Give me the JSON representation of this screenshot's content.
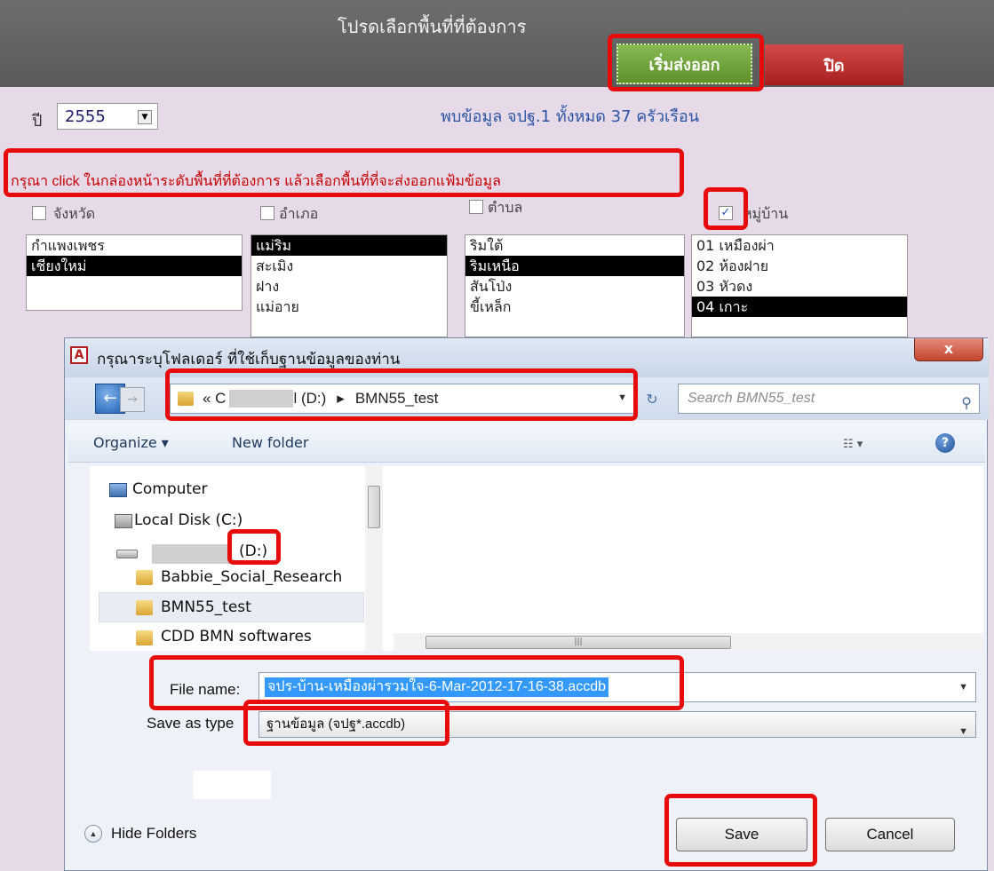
{
  "form": {
    "title": "โปรดเลือกพื้นที่ที่ต้องการ",
    "start_export_label": "เริ่มส่งออก",
    "close_label": "ปิด",
    "year_label": "ปี",
    "year_value": "2555",
    "found_text": "พบข้อมูล จปฐ.1 ทั้งหมด  37  ครัวเรือน",
    "instruction": "กรุณา click ในกล่องหน้าระดับพื้นที่ที่ต้องการ แล้วเลือกพื้นที่ที่จะส่งออกแฟ้มข้อมูล",
    "levels": [
      {
        "label": "จังหวัด",
        "checked": false,
        "items": [
          "กำแพงเพชร",
          "เชียงใหม่"
        ],
        "selected": 1
      },
      {
        "label": "อำเภอ",
        "checked": false,
        "items": [
          "แม่ริม",
          "สะเมิง",
          "ฝาง",
          "แม่อาย"
        ],
        "selected": 0
      },
      {
        "label": "ตำบล",
        "checked": false,
        "items": [
          "ริมใต้",
          "ริมเหนือ",
          "สันโป่ง",
          "ขี้เหล็ก"
        ],
        "selected": 1
      },
      {
        "label": "หมู่บ้าน",
        "checked": true,
        "items": [
          "01 เหมืองผ่า",
          "02 ห้องฝาย",
          "03 หัวดง",
          "04 เกาะ"
        ],
        "selected": 3
      }
    ]
  },
  "dialog": {
    "title": "กรุณาระบุโฟลเดอร์ ที่ใช้เก็บฐานข้อมูลของท่าน",
    "close_glyph": "x",
    "address": {
      "prefix": "«  C",
      "drive": "l (D:)",
      "sep": "▸",
      "folder": "BMN55_test"
    },
    "search_placeholder": "Search BMN55_test",
    "toolbar": {
      "organize": "Organize ▾",
      "new_folder": "New folder",
      "help": "?"
    },
    "nav": [
      {
        "label": "Computer"
      },
      {
        "label": "Local Disk (C:)"
      },
      {
        "label": "(D:)"
      },
      {
        "label": "Babbie_Social_Research"
      },
      {
        "label": "BMN55_test"
      },
      {
        "label": "CDD BMN softwares"
      }
    ],
    "file_name_label": "File name:",
    "file_name_value": "จปร-บ้าน-เหมืองผ่ารวมใจ-6-Mar-2012-17-16-38.accdb",
    "save_type_label": "Save as type",
    "save_type_value": "ฐานข้อมูล (จปฐ*.accdb)",
    "hide_folders": "Hide Folders",
    "save_label": "Save",
    "cancel_label": "Cancel"
  }
}
